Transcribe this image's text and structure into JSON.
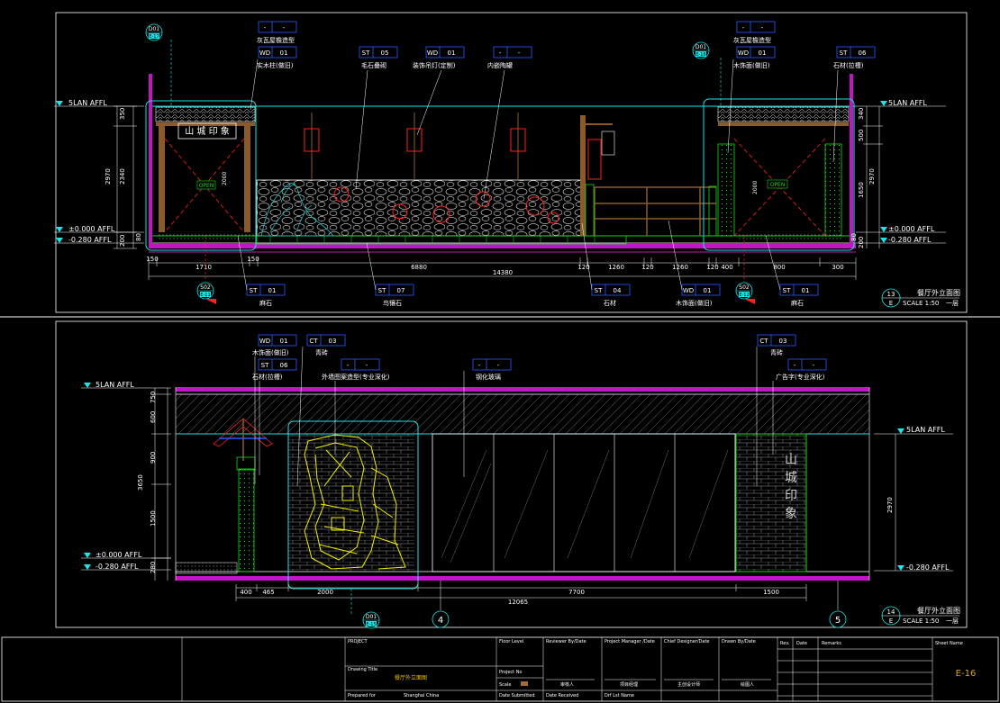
{
  "upper": {
    "callout_d01_left": {
      "top": "D01",
      "bottom": "E-17"
    },
    "callout_d01_right": {
      "top": "D01",
      "bottom": "E-16"
    },
    "callout_s02_left": {
      "top": "S02",
      "bottom": "E-11"
    },
    "callout_s02_right": {
      "top": "S02",
      "bottom": "E-12"
    },
    "tags_top": [
      {
        "code": "-",
        "num": "-",
        "desc": "灰瓦屋檐造型"
      },
      {
        "code": "WD",
        "num": "01",
        "desc": "实木柱(做旧)"
      },
      {
        "code": "ST",
        "num": "05",
        "desc": "毛石叠砌"
      },
      {
        "code": "WD",
        "num": "01",
        "desc": "装饰吊灯(定制)"
      },
      {
        "code": "-",
        "num": "-",
        "desc": "内嵌陶罐"
      },
      {
        "code": "-",
        "num": "-",
        "desc": "灰瓦屋檐造型"
      },
      {
        "code": "WD",
        "num": "01",
        "desc": "木饰面(做旧)"
      },
      {
        "code": "ST",
        "num": "06",
        "desc": "石材(拉槽)"
      }
    ],
    "tags_bottom": [
      {
        "code": "ST",
        "num": "01",
        "desc": "麻石"
      },
      {
        "code": "ST",
        "num": "07",
        "desc": "鸟镶石"
      },
      {
        "code": "ST",
        "num": "04",
        "desc": "石材"
      },
      {
        "code": "WD",
        "num": "01",
        "desc": "木饰面(做旧)"
      },
      {
        "code": "ST",
        "num": "01",
        "desc": "麻石"
      }
    ],
    "levels_left": [
      "5LAN AFFL",
      "±0.000 AFFL",
      "-0.280 AFFL"
    ],
    "levels_right": [
      "5LAN AFFL",
      "±0.000 AFFL",
      "-0.280 AFFL"
    ],
    "vdims_left": [
      "350",
      "2970",
      "2340",
      "200",
      "80"
    ],
    "vdims_right": [
      "340",
      "500",
      "2970",
      "1650",
      "80",
      "200"
    ],
    "door_left": "OPEN",
    "door_right": "OPEN",
    "door_height": "2000",
    "sign_text": "山 城 印 象",
    "hdims": [
      "150",
      "1710",
      "150",
      "6880",
      "120",
      "1260",
      "120",
      "1260",
      "120",
      "400",
      "800",
      "300"
    ],
    "total": "14380",
    "title": {
      "num": "13",
      "letter": "E",
      "name": "餐厅外立面图",
      "scale": "SCALE 1:50",
      "floor": "一层"
    }
  },
  "lower": {
    "callout_d01": {
      "top": "D01",
      "bottom": "E-15"
    },
    "tags_top": [
      {
        "code": "WD",
        "num": "01",
        "desc": "木饰面(做旧)"
      },
      {
        "code": "ST",
        "num": "06",
        "desc": "石材(拉槽)"
      },
      {
        "code": "CT",
        "num": "03",
        "desc": "青砖"
      },
      {
        "code": "-",
        "num": "-",
        "desc": "外墙图案造型(专业深化)"
      },
      {
        "code": "-",
        "num": "-",
        "desc": "钢化玻璃"
      },
      {
        "code": "CT",
        "num": "03",
        "desc": "青砖"
      },
      {
        "code": "-",
        "num": "-",
        "desc": "广告字(专业深化)"
      }
    ],
    "levels_left": [
      "5LAN AFFL",
      "±0.000 AFFL",
      "-0.280 AFFL"
    ],
    "levels_right": [
      "5LAN AFFL",
      "-0.280 AFFL"
    ],
    "vdims_left": [
      "750",
      "600",
      "900",
      "3650",
      "1500",
      "280"
    ],
    "vdim_right": "2970",
    "sign_chars": [
      "山",
      "城",
      "印",
      "象"
    ],
    "hdims": [
      "400",
      "465",
      "2000",
      "7700",
      "1500"
    ],
    "total": "12065",
    "grid_a": "4",
    "grid_b": "5",
    "title": {
      "num": "14",
      "letter": "E",
      "name": "餐厅外立面图",
      "scale": "SCALE 1:50",
      "floor": "一层"
    }
  },
  "titleblock": {
    "project_label": "PROJECT",
    "drawing_title_label": "Drawing Title",
    "drawing_title": "餐厅外立面图",
    "prepared_label": "Prepared for",
    "prepared_value": "Shanghai China",
    "floor_level_label": "Floor Level",
    "project_no_label": "Project No",
    "scale_label": "Scale",
    "date_submitted_label": "Date Submitted",
    "reviewer_label": "Reviewer By/Date",
    "date_received_label": "Date Received",
    "pm_label": "Project Manager /Date",
    "drafted_label": "Drf Lst Name",
    "chief_label": "Chief Designer/Date",
    "drawn_label": "Drawn By/Date",
    "reviewer_value": "审核人",
    "pm_value": "项目经理",
    "chief_value": "主创设计师",
    "drawn_value": "绘图人",
    "rev_label": "Rev.",
    "date_label": "Date",
    "remarks_label": "Remarks",
    "sheet_label": "Sheet Name",
    "sheet_no": "E-16"
  }
}
